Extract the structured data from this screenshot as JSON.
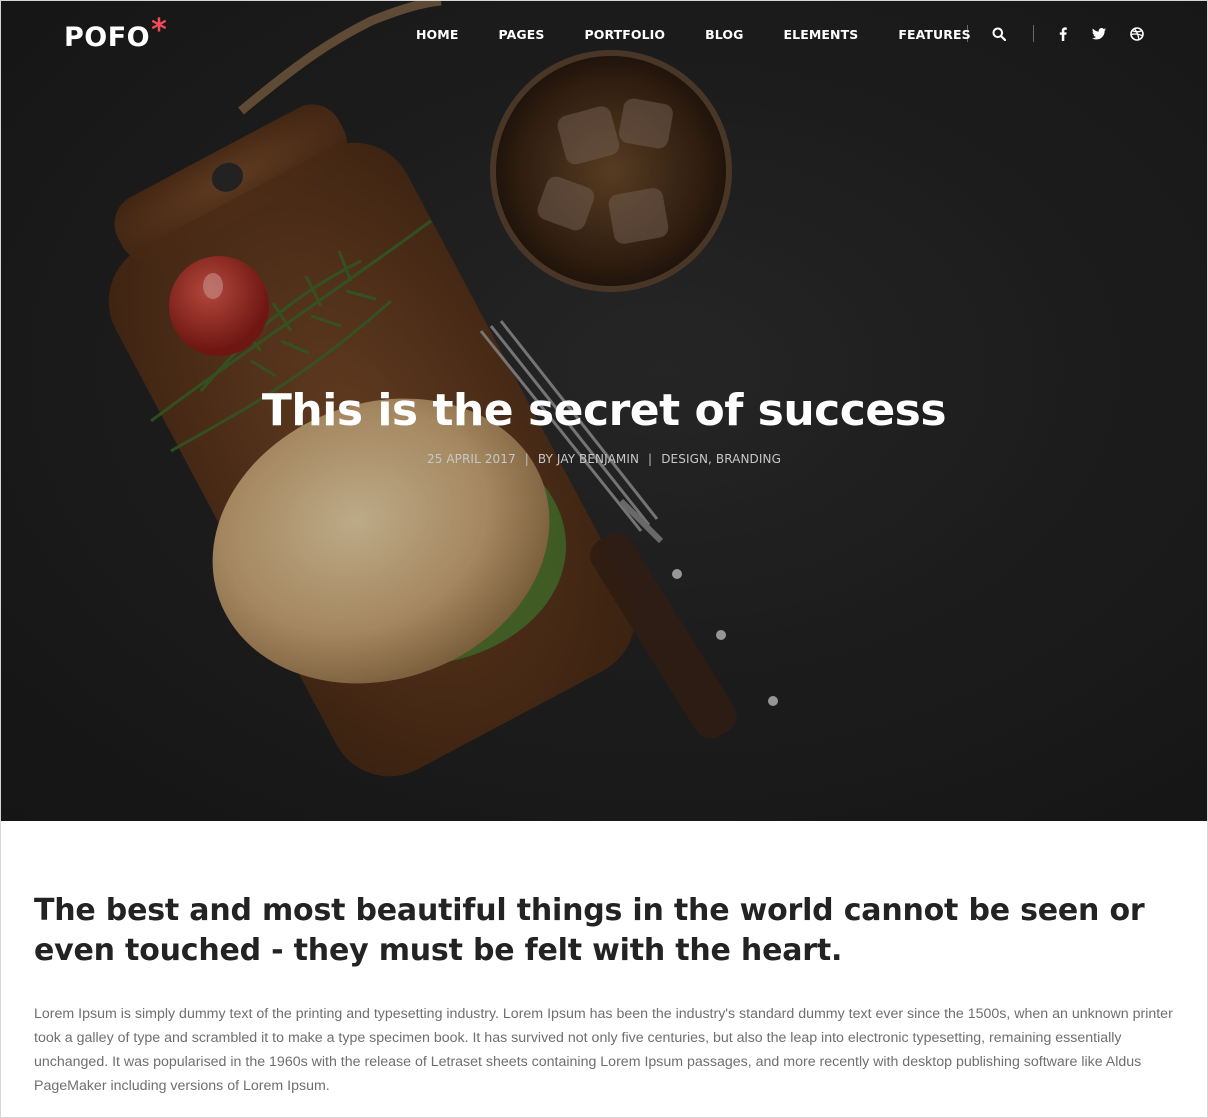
{
  "brand": {
    "name": "POFO",
    "mark": "*",
    "mark_color": "#f04b5a"
  },
  "nav": {
    "items": [
      "HOME",
      "PAGES",
      "PORTFOLIO",
      "BLOG",
      "ELEMENTS",
      "FEATURES"
    ],
    "icons": [
      "search-icon",
      "facebook-icon",
      "twitter-icon",
      "dribbble-icon"
    ]
  },
  "hero": {
    "title": "This is the secret of success",
    "date": "25 APRIL 2017",
    "separator": "|",
    "author": "BY JAY BENJAMIN",
    "categories": "DESIGN, BRANDING"
  },
  "article": {
    "lead": "The best and most beautiful things in the world cannot be seen or even touched - they must be felt with the heart.",
    "body": "Lorem Ipsum is simply dummy text of the printing and typesetting industry. Lorem Ipsum has been the industry's standard dummy text ever since the 1500s, when an unknown printer took a galley of type and scrambled it to make a type specimen book. It has survived not only five centuries, but also the leap into electronic typesetting, remaining essentially unchanged. It was popularised in the 1960s with the release of Letraset sheets containing Lorem Ipsum passages, and more recently with desktop publishing software like Aldus PageMaker including versions of Lorem Ipsum."
  },
  "colors": {
    "hero_bg": "#232323",
    "heading": "#232323",
    "body_text": "#6f6f6f",
    "accent": "#f04b5a"
  }
}
